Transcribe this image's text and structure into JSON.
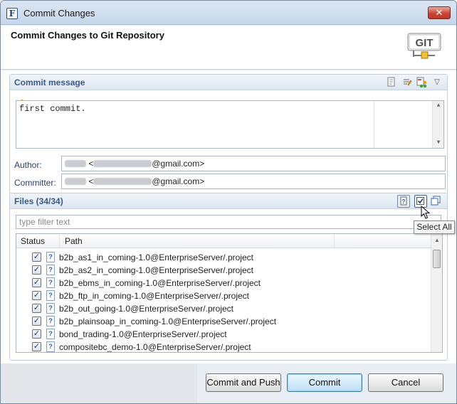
{
  "window": {
    "title": "Commit Changes",
    "app_icon_letter": "F"
  },
  "header": {
    "title": "Commit Changes to Git Repository",
    "logo_text": "GIT"
  },
  "commit_message": {
    "section_title": "Commit message",
    "text": "first commit."
  },
  "author": {
    "label": "Author:",
    "value_suffix": "@gmail.com>",
    "value_prefix": "<"
  },
  "committer": {
    "label": "Committer:",
    "value_suffix": "@gmail.com>",
    "value_prefix": "<"
  },
  "files": {
    "section_title": "Files (34/34)",
    "filter_placeholder": "type filter text",
    "columns": {
      "status": "Status",
      "path": "Path"
    },
    "rows": [
      "b2b_as1_in_coming-1.0@EnterpriseServer/.project",
      "b2b_as2_in_coming-1.0@EnterpriseServer/.project",
      "b2b_ebms_in_coming-1.0@EnterpriseServer/.project",
      "b2b_ftp_in_coming-1.0@EnterpriseServer/.project",
      "b2b_out_going-1.0@EnterpriseServer/.project",
      "b2b_plainsoap_in_coming-1.0@EnterpriseServer/.project",
      "bond_trading-1.0@EnterpriseServer/.project",
      "compositebc_demo-1.0@EnterpriseServer/.project"
    ]
  },
  "tooltip": "Select All",
  "buttons": {
    "commit_and_push": "Commit and Push",
    "commit": "Commit",
    "cancel": "Cancel"
  },
  "icons": [
    "app-icon",
    "close-icon",
    "git-logo-icon",
    "spellcheck-icon",
    "sign-off-icon",
    "amend-icon",
    "menu-chevron-icon",
    "show-untracked-icon",
    "select-all-icon",
    "deselect-all-icon",
    "checkbox-icon",
    "file-icon",
    "lightbulb-icon",
    "mouse-cursor-icon"
  ]
}
